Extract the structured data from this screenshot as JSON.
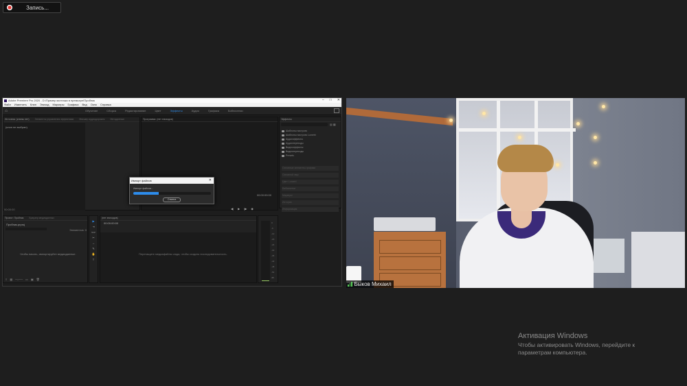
{
  "recording": {
    "label": "Запись..."
  },
  "premiere": {
    "title": "Adobe Premiere Pro 2020 - D:\\Пример монтажа в премьере\\Пробник",
    "menu": [
      "Файл",
      "Изменить",
      "Клип",
      "Эпизод",
      "Маркеры",
      "Графика",
      "Вид",
      "Окно",
      "Справка"
    ],
    "workspaces": [
      "Обучение",
      "Сборка",
      "Редактирование",
      "Цвет",
      "Эффекты",
      "Аудио",
      "Графика",
      "Библиотеки"
    ],
    "active_workspace": "Эффекты",
    "source_panel": {
      "tabs": [
        "Источник: (клипы нет)",
        "Элементы управления эффектами",
        "Микшер аудиодорожек",
        "Метаданные"
      ],
      "empty_label": "(клип не выбран)",
      "timecode": "00:00:00"
    },
    "program_panel": {
      "tab": "Программа: (нет эпизодов)",
      "timecode": "00:00:00:00"
    },
    "effects_panel": {
      "tab": "Эффекты",
      "folders": [
        "Шаблоны настроек",
        "Шаблоны настроек Lumetri",
        "Аудиоэффекты",
        "Аудиопереходы",
        "Видеоэффекты",
        "Видеопереходы",
        "Presets"
      ],
      "sections": [
        "Основные элементы графики",
        "Основной звук",
        "Цвет Lumetri",
        "Библиотеки",
        "Маркеры",
        "История",
        "Информация"
      ]
    },
    "project_panel": {
      "tabs": [
        "Проект: Пробник",
        "Браузер медиаданных"
      ],
      "project_file": "Пробник.prproj",
      "items_label": "Элементов: 0",
      "hint": "Чтобы начать, импортируйте медиаданные."
    },
    "timeline_panel": {
      "tab": "(нет эпизодов)",
      "timecode": "00:00:00:00",
      "hint": "Перетащите медиафайлы сюда, чтобы создать последовательность."
    },
    "meter_ticks": [
      "0",
      "-6",
      "-12",
      "-18",
      "-24",
      "-30",
      "-36",
      "-42",
      "-48",
      "-54",
      "dB"
    ],
    "import_dialog": {
      "title": "Импорт файлов",
      "message": "Импорт файлов...",
      "progress_fraction": 0.33,
      "cancel_label": "Отмена"
    }
  },
  "video": {
    "participant_name": "Быков Михаил"
  },
  "activation": {
    "title": "Активация Windows",
    "body": "Чтобы активировать Windows, перейдите к параметрам компьютера."
  },
  "colors": {
    "accent": "#2d8ceb",
    "background": "#1e1e1e"
  }
}
